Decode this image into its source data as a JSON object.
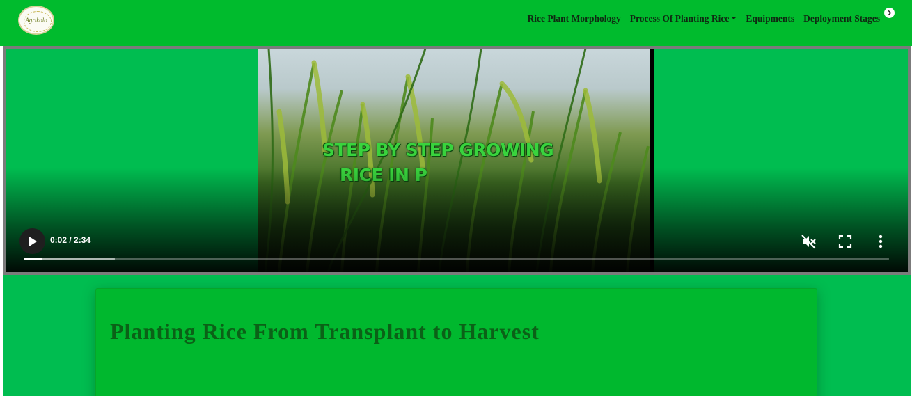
{
  "colors": {
    "navbar_bg": "#00bb2d",
    "page_bg": "#00bd50",
    "card_bg": "#00b82e",
    "title_color": "#0b6117"
  },
  "brand": {
    "logo_text": "Agrikolo"
  },
  "nav": {
    "items": [
      {
        "label": "Rice Plant Morphology",
        "has_dropdown": false
      },
      {
        "label": "Process Of Planting Rice",
        "has_dropdown": true
      },
      {
        "label": "Equipments",
        "has_dropdown": false
      },
      {
        "label": "Deployment Stages",
        "has_dropdown": false
      }
    ],
    "next_icon": "chevron-right-icon"
  },
  "video": {
    "caption_line1": "STEP BY STEP GROWING",
    "caption_line2": "RICE IN P",
    "time_display": "0:02 / 2:34",
    "current_seconds": 2,
    "duration_seconds": 154,
    "played_fraction": 0.022,
    "buffered_fraction": 0.105,
    "muted": true,
    "icons": [
      "play-icon",
      "volume-off-icon",
      "fullscreen-icon",
      "more-options-icon"
    ]
  },
  "card": {
    "title": "Planting Rice From Transplant to Harvest"
  }
}
